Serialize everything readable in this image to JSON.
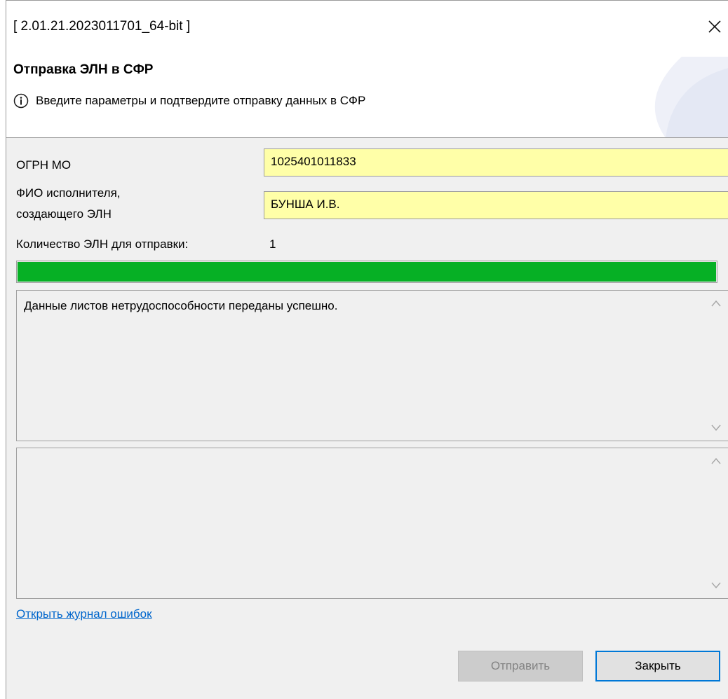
{
  "window": {
    "title": "[ 2.01.21.2023011701_64-bit ]",
    "close_icon": "close-icon"
  },
  "header": {
    "title": "Отправка ЭЛН в СФР",
    "info_icon": "info-icon",
    "info_text": "Введите параметры и подтвердите отправку данных в СФР"
  },
  "form": {
    "ogrn_label": "ОГРН МО",
    "ogrn_value": "1025401011833",
    "executor_label_line1": "ФИО исполнителя,",
    "executor_label_line2": "создающего ЭЛН",
    "executor_value": "БУНША И.В.",
    "count_label": "Количество ЭЛН для отправки:",
    "count_value": "1"
  },
  "progress": {
    "percent": 100,
    "fill_color": "#06b025"
  },
  "log": {
    "message": "Данные листов нетрудоспособности переданы успешно.",
    "errors_message": ""
  },
  "links": {
    "open_error_log": "Открыть журнал ошибок"
  },
  "buttons": {
    "send_label": "Отправить",
    "send_enabled": false,
    "close_label": "Закрыть"
  },
  "colors": {
    "field_background": "#ffffa8",
    "link": "#0066cc",
    "focus_border": "#0078d7"
  }
}
